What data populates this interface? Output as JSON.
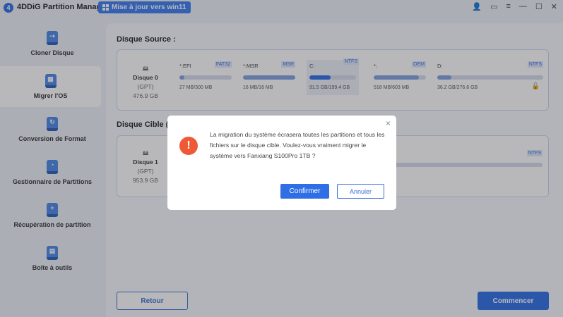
{
  "app": {
    "title": "4DDiG Partition Manager",
    "update_button": "Mise à jour vers win11"
  },
  "sidebar": {
    "items": [
      {
        "label": "Cloner Disque"
      },
      {
        "label": "Migrer l'OS"
      },
      {
        "label": "Conversion de Format"
      },
      {
        "label": "Gestionnaire de Partitions"
      },
      {
        "label": "Récupération de partition"
      },
      {
        "label": "Boîte à outils"
      }
    ]
  },
  "source": {
    "heading": "Disque Source :",
    "disk": {
      "name": "Disque 0",
      "type": "(GPT)",
      "size": "476.9 GB"
    },
    "partitions": [
      {
        "name": "*:EFI",
        "fs": "FAT32",
        "usage": "27 MB/300 MB",
        "fill": 9
      },
      {
        "name": "*:MSR",
        "fs": "MSR",
        "usage": "16 MB/16 MB",
        "fill": 100
      },
      {
        "name": "C:",
        "fs": "NTFS",
        "usage": "91.5 GB/199.4 GB",
        "fill": 46
      },
      {
        "name": "*:",
        "fs": "OEM",
        "usage": "518 MB/603 MB",
        "fill": 86
      },
      {
        "name": "D:",
        "fs": "NTFS",
        "usage": "36.2 GB/276.6 GB",
        "fill": 13
      }
    ]
  },
  "target": {
    "heading": "Disque Cible (R",
    "disk": {
      "name": "Disque 1",
      "type": "(GPT)",
      "size": "953.9 GB"
    },
    "fs": "NTFS"
  },
  "footer": {
    "back": "Retour",
    "start": "Commencer"
  },
  "dialog": {
    "message": "La migration du système écrasera toutes les partitions et tous les fichiers sur le disque cible. Voulez-vous vraiment migrer le système vers Fanxiang S100Pro 1TB ?",
    "confirm": "Confirmer",
    "cancel": "Annuler",
    "close": "×",
    "warn": "!"
  }
}
